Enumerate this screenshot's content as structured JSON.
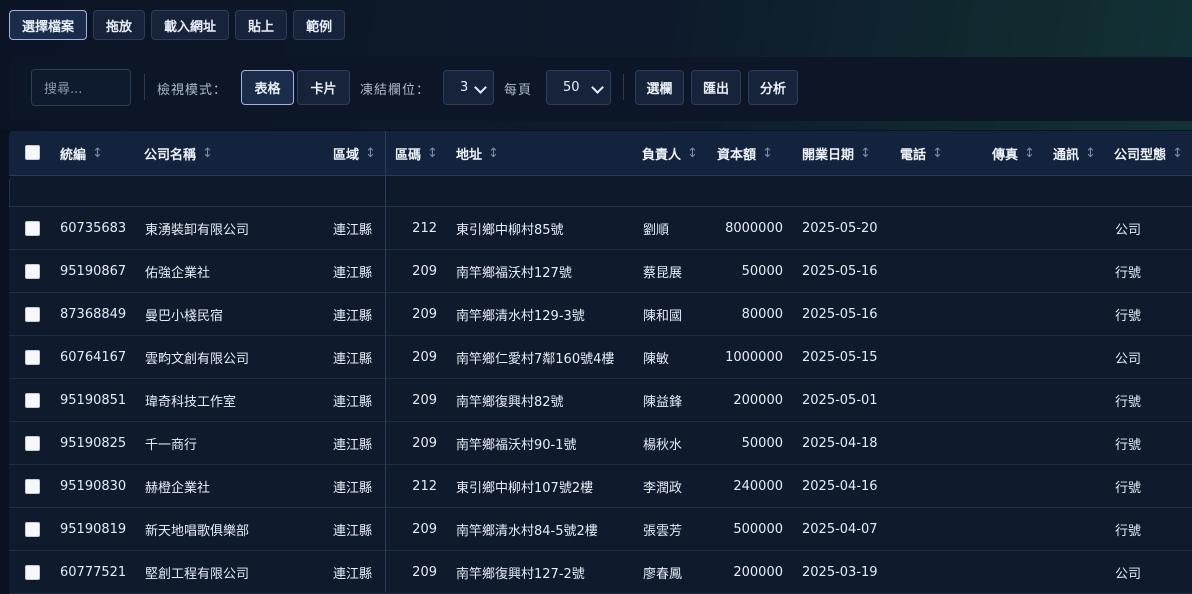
{
  "top_tabs": [
    {
      "label": "選擇檔案",
      "active": true
    },
    {
      "label": "拖放"
    },
    {
      "label": "載入網址"
    },
    {
      "label": "貼上"
    },
    {
      "label": "範例"
    }
  ],
  "toolbar": {
    "search_placeholder": "搜尋...",
    "view_mode_label": "檢視模式：",
    "view_table": "表格",
    "view_card": "卡片",
    "freeze_label": "凍結欄位：",
    "freeze_value": "3",
    "page_size_label": "每頁",
    "page_size_value": "50",
    "select_cols": "選欄",
    "export": "匯出",
    "analyze": "分析"
  },
  "columns": [
    "統編",
    "公司名稱",
    "區域",
    "區碼",
    "地址",
    "負責人",
    "資本額",
    "開業日期",
    "電話",
    "傳真",
    "通訊",
    "公司型態"
  ],
  "sort_icon": "↕",
  "rows": [
    [
      "60735683",
      "東湧裝卸有限公司",
      "連江縣",
      "212",
      "東引鄉中柳村85號",
      "劉順",
      "8000000",
      "2025-05-20",
      "",
      "",
      "",
      "公司"
    ],
    [
      "95190867",
      "佑強企業社",
      "連江縣",
      "209",
      "南竿鄉福沃村127號",
      "蔡昆展",
      "50000",
      "2025-05-16",
      "",
      "",
      "",
      "行號"
    ],
    [
      "87368849",
      "曼巴小棧民宿",
      "連江縣",
      "209",
      "南竿鄉清水村129-3號",
      "陳和國",
      "80000",
      "2025-05-16",
      "",
      "",
      "",
      "行號"
    ],
    [
      "60764167",
      "雲畇文創有限公司",
      "連江縣",
      "209",
      "南竿鄉仁愛村7鄰160號4樓",
      "陳敏",
      "1000000",
      "2025-05-15",
      "",
      "",
      "",
      "公司"
    ],
    [
      "95190851",
      "瑋奇科技工作室",
      "連江縣",
      "209",
      "南竿鄉復興村82號",
      "陳益鋒",
      "200000",
      "2025-05-01",
      "",
      "",
      "",
      "行號"
    ],
    [
      "95190825",
      "千一商行",
      "連江縣",
      "209",
      "南竿鄉福沃村90-1號",
      "楊秋水",
      "50000",
      "2025-04-18",
      "",
      "",
      "",
      "行號"
    ],
    [
      "95190830",
      "赫橙企業社",
      "連江縣",
      "212",
      "東引鄉中柳村107號2樓",
      "李潤政",
      "240000",
      "2025-04-16",
      "",
      "",
      "",
      "行號"
    ],
    [
      "95190819",
      "新天地唱歌俱樂部",
      "連江縣",
      "209",
      "南竿鄉清水村84-5號2樓",
      "張雲芳",
      "500000",
      "2025-04-07",
      "",
      "",
      "",
      "行號"
    ],
    [
      "60777521",
      "堅創工程有限公司",
      "連江縣",
      "209",
      "南竿鄉復興村127-2號",
      "廖春鳳",
      "200000",
      "2025-03-19",
      "",
      "",
      "",
      "公司"
    ]
  ]
}
